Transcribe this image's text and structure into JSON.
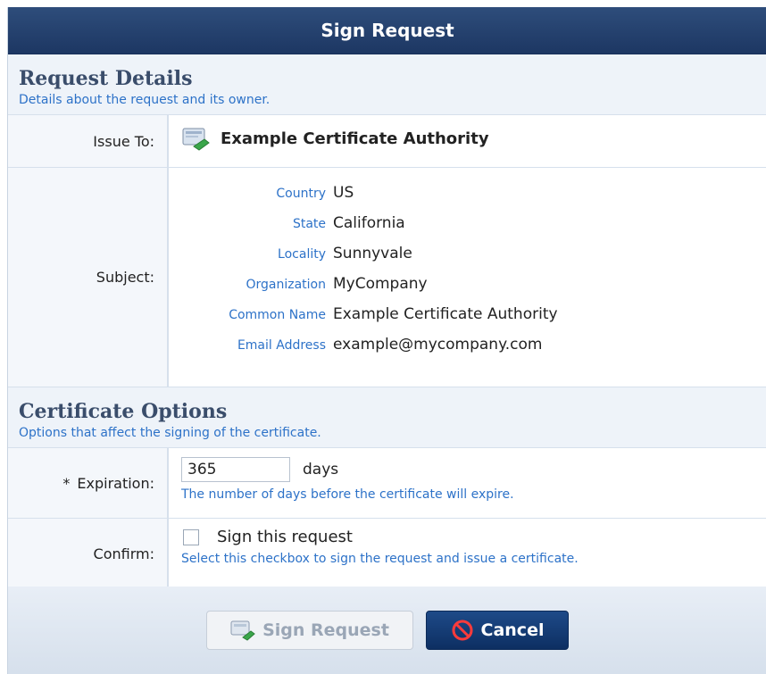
{
  "dialog": {
    "title": "Sign Request"
  },
  "request_details": {
    "title": "Request Details",
    "subtitle": "Details about the request and its owner.",
    "issue_to": {
      "label": "Issue To:",
      "value": "Example Certificate Authority",
      "icon": "certificate-icon"
    },
    "subject": {
      "label": "Subject:",
      "fields": [
        {
          "key": "Country",
          "value": "US"
        },
        {
          "key": "State",
          "value": "California"
        },
        {
          "key": "Locality",
          "value": "Sunnyvale"
        },
        {
          "key": "Organization",
          "value": "MyCompany"
        },
        {
          "key": "Common Name",
          "value": "Example Certificate Authority"
        },
        {
          "key": "Email Address",
          "value": "example@mycompany.com"
        }
      ]
    }
  },
  "certificate_options": {
    "title": "Certificate Options",
    "subtitle": "Options that affect the signing of the certificate.",
    "expiration": {
      "required_marker": "*",
      "label": "Expiration:",
      "value": "365",
      "unit": "days",
      "hint": "The number of days before the certificate will expire."
    },
    "confirm": {
      "label": "Confirm:",
      "checkbox_label": "Sign this request",
      "checked": false,
      "hint": "Select this checkbox to sign the request and issue a certificate."
    }
  },
  "footer": {
    "sign_button": "Sign Request",
    "cancel_button": "Cancel"
  },
  "colors": {
    "titlebar": "#1d3763",
    "accent_text": "#2d72c8",
    "cancel_button": "#0d2f62"
  }
}
